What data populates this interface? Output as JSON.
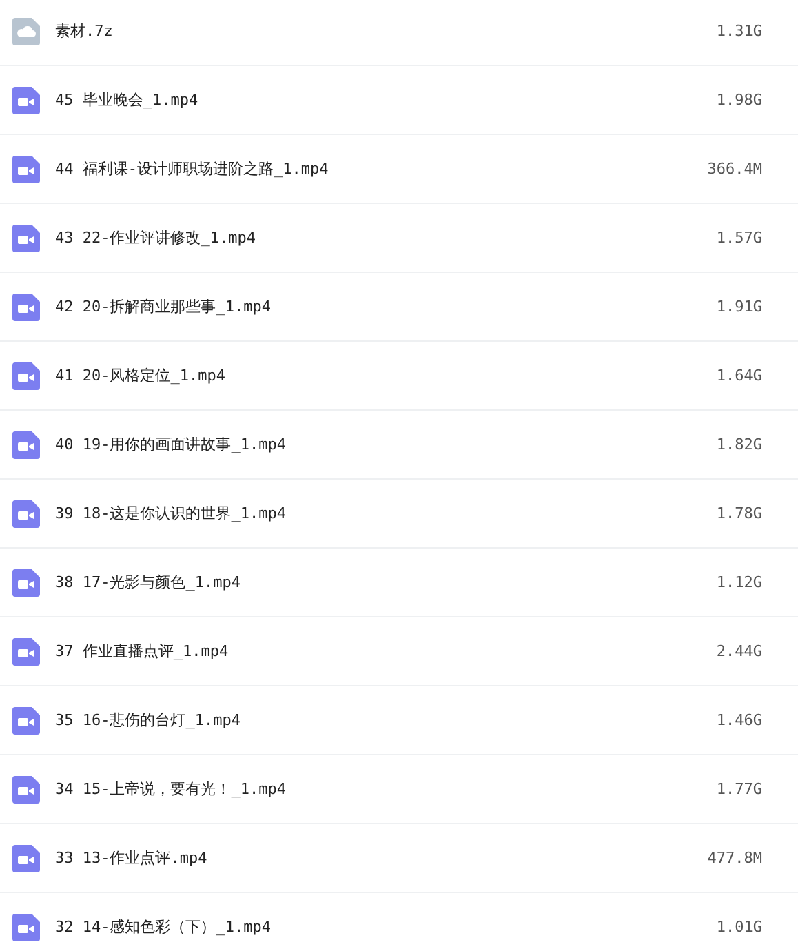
{
  "files": [
    {
      "kind": "archive",
      "name": "素材.7z",
      "size": "1.31G"
    },
    {
      "kind": "video",
      "name": "45 毕业晚会_1.mp4",
      "size": "1.98G"
    },
    {
      "kind": "video",
      "name": "44 福利课-设计师职场进阶之路_1.mp4",
      "size": "366.4M"
    },
    {
      "kind": "video",
      "name": "43 22-作业评讲修改_1.mp4",
      "size": "1.57G"
    },
    {
      "kind": "video",
      "name": "42 20-拆解商业那些事_1.mp4",
      "size": "1.91G"
    },
    {
      "kind": "video",
      "name": "41 20-风格定位_1.mp4",
      "size": "1.64G"
    },
    {
      "kind": "video",
      "name": "40 19-用你的画面讲故事_1.mp4",
      "size": "1.82G"
    },
    {
      "kind": "video",
      "name": "39 18-这是你认识的世界_1.mp4",
      "size": "1.78G"
    },
    {
      "kind": "video",
      "name": "38 17-光影与颜色_1.mp4",
      "size": "1.12G"
    },
    {
      "kind": "video",
      "name": "37 作业直播点评_1.mp4",
      "size": "2.44G"
    },
    {
      "kind": "video",
      "name": "35 16-悲伤的台灯_1.mp4",
      "size": "1.46G"
    },
    {
      "kind": "video",
      "name": "34 15-上帝说，要有光！_1.mp4",
      "size": "1.77G"
    },
    {
      "kind": "video",
      "name": "33 13-作业点评.mp4",
      "size": "477.8M"
    },
    {
      "kind": "video",
      "name": "32 14-感知色彩（下）_1.mp4",
      "size": "1.01G"
    }
  ]
}
